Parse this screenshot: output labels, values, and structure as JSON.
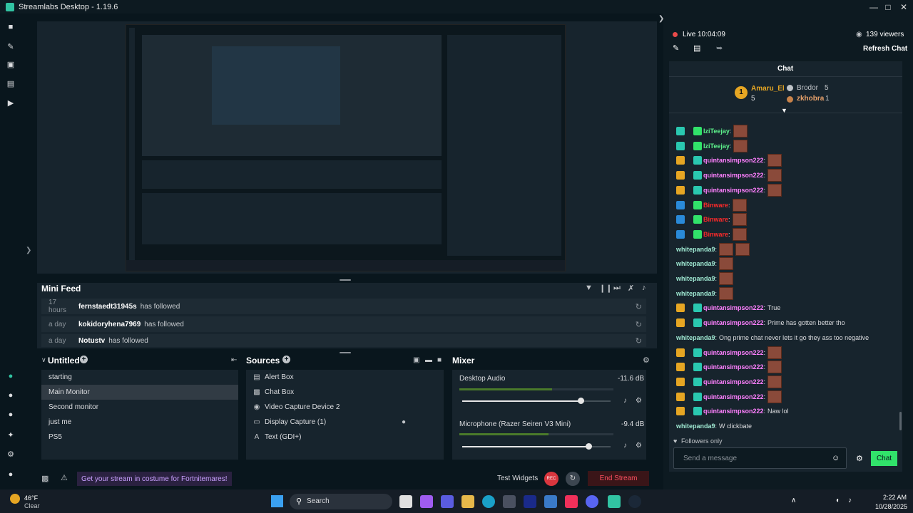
{
  "window": {
    "title": "Streamlabs Desktop - 1.19.6"
  },
  "mini_feed": {
    "title": "Mini Feed",
    "rows": [
      {
        "age": "17 hours",
        "user": "fernstaedt31945s",
        "action": "has followed"
      },
      {
        "age": "a day",
        "user": "kokidoryhena7969",
        "action": "has followed"
      },
      {
        "age": "a day",
        "user": "Notustv",
        "action": "has followed"
      }
    ]
  },
  "scenes": {
    "title": "Untitled",
    "items": [
      "starting",
      "Main Monitor",
      "Second monitor",
      "just me",
      "PS5"
    ],
    "selected_index": 1
  },
  "sources": {
    "title": "Sources",
    "items": [
      {
        "label": "Alert Box",
        "icon": "alert-box-icon"
      },
      {
        "label": "Chat Box",
        "icon": "chat-box-icon"
      },
      {
        "label": "Video Capture Device 2",
        "icon": "camera-icon"
      },
      {
        "label": "Display Capture (1)",
        "icon": "monitor-icon"
      },
      {
        "label": "Text (GDI+)",
        "icon": "text-icon"
      }
    ]
  },
  "mixer": {
    "title": "Mixer",
    "channels": [
      {
        "name": "Desktop Audio",
        "db": "-11.6 dB",
        "volume": 0.8,
        "level": 0.6
      },
      {
        "name": "Microphone (Razer Seiren V3 Mini)",
        "db": "-9.4 dB",
        "volume": 0.85,
        "level": 0.58
      }
    ]
  },
  "footer": {
    "promo": "Get your stream in costume for Fortnitemares!",
    "test_widgets": "Test Widgets",
    "end_stream": "End Stream"
  },
  "chat_header": {
    "live_label": "Live",
    "live_time": "10:04:09",
    "viewers": "139 viewers",
    "refresh": "Refresh Chat"
  },
  "chat": {
    "title": "Chat",
    "leader": {
      "rank": "1",
      "name": "Amaru_El",
      "count": "5"
    },
    "leaders_side": [
      {
        "name": "Brodor",
        "count": "5"
      },
      {
        "name": "zkhobra",
        "count": "1"
      }
    ],
    "messages": [
      {
        "user": "IziTeejay",
        "text": "",
        "color": "#5cf08a",
        "emotes": 1
      },
      {
        "user": "IziTeejay",
        "text": "",
        "color": "#5cf08a",
        "emotes": 1
      },
      {
        "user": "quintansimpson222",
        "text": "",
        "color": "#ff80ff",
        "emotes": 1
      },
      {
        "user": "quintansimpson222",
        "text": "",
        "color": "#ff80ff",
        "emotes": 1
      },
      {
        "user": "quintansimpson222",
        "text": "",
        "color": "#ff80ff",
        "emotes": 1
      },
      {
        "user": "Binware",
        "text": "",
        "color": "#ff2a2a",
        "emotes": 1
      },
      {
        "user": "Binware",
        "text": "",
        "color": "#ff2a2a",
        "emotes": 1
      },
      {
        "user": "Binware",
        "text": "",
        "color": "#ff2a2a",
        "emotes": 1
      },
      {
        "user": "whitepanda9",
        "text": "",
        "color": "#9fe8d2",
        "emotes": 2
      },
      {
        "user": "whitepanda9",
        "text": "",
        "color": "#9fe8d2",
        "emotes": 1
      },
      {
        "user": "whitepanda9",
        "text": "",
        "color": "#9fe8d2",
        "emotes": 1
      },
      {
        "user": "whitepanda9",
        "text": "",
        "color": "#9fe8d2",
        "emotes": 1
      },
      {
        "user": "quintansimpson222",
        "text": "True",
        "color": "#ff80ff",
        "emotes": 0
      },
      {
        "user": "quintansimpson222",
        "text": "Prime has gotten better tho",
        "color": "#ff80ff",
        "emotes": 0
      },
      {
        "user": "whitepanda9",
        "text": "Ong prime chat never lets it go they ass too negative",
        "color": "#9fe8d2",
        "emotes": 0
      },
      {
        "user": "quintansimpson222",
        "text": "",
        "color": "#ff80ff",
        "emotes": 1
      },
      {
        "user": "quintansimpson222",
        "text": "",
        "color": "#ff80ff",
        "emotes": 1
      },
      {
        "user": "quintansimpson222",
        "text": "",
        "color": "#ff80ff",
        "emotes": 1
      },
      {
        "user": "quintansimpson222",
        "text": "",
        "color": "#ff80ff",
        "emotes": 1
      },
      {
        "user": "quintansimpson222",
        "text": "Naw lol",
        "color": "#ff80ff",
        "emotes": 0
      },
      {
        "user": "whitepanda9",
        "text": "W clickbate",
        "color": "#9fe8d2",
        "emotes": 0
      }
    ],
    "followers_only": "Followers only",
    "input_placeholder": "Send a message",
    "send_label": "Chat"
  },
  "taskbar": {
    "weather_temp": "46°F",
    "weather_desc": "Clear",
    "search_label": "Search",
    "time": "2:22 AM",
    "date": "10/28/2025"
  }
}
